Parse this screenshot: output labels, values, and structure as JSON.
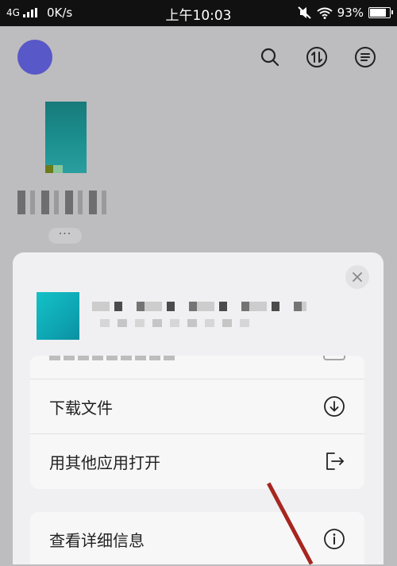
{
  "status_bar": {
    "network": "4G",
    "speed": "0K/s",
    "time": "上午10:03",
    "battery": "93%",
    "battery_level": 0.93
  },
  "toolbar": {
    "icons": [
      "search-icon",
      "sort-icon",
      "menu-icon"
    ]
  },
  "file_tile": {
    "more_label": "···"
  },
  "sheet": {
    "close_icon": "close-icon",
    "actions": [
      {
        "label": "下载文件",
        "icon": "download-icon"
      },
      {
        "label": "用其他应用打开",
        "icon": "open-external-icon"
      }
    ],
    "details": {
      "label": "查看详细信息",
      "icon": "info-icon"
    }
  },
  "colors": {
    "avatar": "#5858c8",
    "annotation_arrow": "#a6261f",
    "dim_background": "#bdbcbe",
    "sheet_background": "#f0eff1"
  }
}
